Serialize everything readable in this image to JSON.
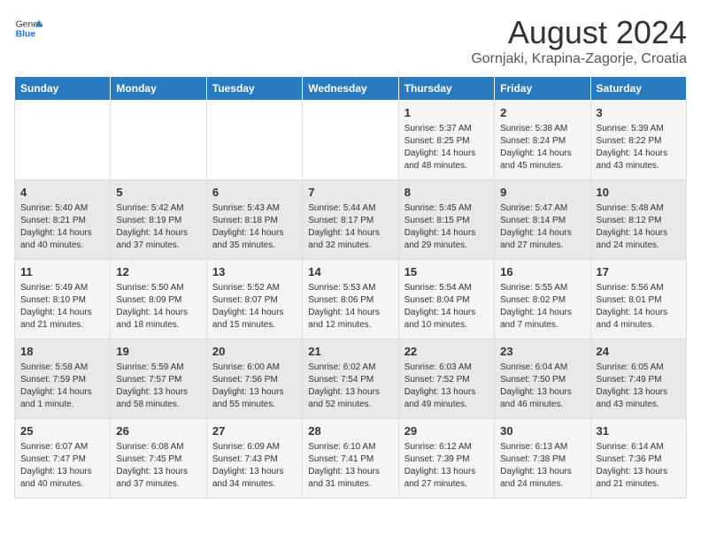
{
  "header": {
    "logo_general": "General",
    "logo_blue": "Blue",
    "month_title": "August 2024",
    "location": "Gornjaki, Krapina-Zagorje, Croatia"
  },
  "weekdays": [
    "Sunday",
    "Monday",
    "Tuesday",
    "Wednesday",
    "Thursday",
    "Friday",
    "Saturday"
  ],
  "weeks": [
    [
      {
        "day": "",
        "info": ""
      },
      {
        "day": "",
        "info": ""
      },
      {
        "day": "",
        "info": ""
      },
      {
        "day": "",
        "info": ""
      },
      {
        "day": "1",
        "info": "Sunrise: 5:37 AM\nSunset: 8:25 PM\nDaylight: 14 hours and 48 minutes."
      },
      {
        "day": "2",
        "info": "Sunrise: 5:38 AM\nSunset: 8:24 PM\nDaylight: 14 hours and 45 minutes."
      },
      {
        "day": "3",
        "info": "Sunrise: 5:39 AM\nSunset: 8:22 PM\nDaylight: 14 hours and 43 minutes."
      }
    ],
    [
      {
        "day": "4",
        "info": "Sunrise: 5:40 AM\nSunset: 8:21 PM\nDaylight: 14 hours and 40 minutes."
      },
      {
        "day": "5",
        "info": "Sunrise: 5:42 AM\nSunset: 8:19 PM\nDaylight: 14 hours and 37 minutes."
      },
      {
        "day": "6",
        "info": "Sunrise: 5:43 AM\nSunset: 8:18 PM\nDaylight: 14 hours and 35 minutes."
      },
      {
        "day": "7",
        "info": "Sunrise: 5:44 AM\nSunset: 8:17 PM\nDaylight: 14 hours and 32 minutes."
      },
      {
        "day": "8",
        "info": "Sunrise: 5:45 AM\nSunset: 8:15 PM\nDaylight: 14 hours and 29 minutes."
      },
      {
        "day": "9",
        "info": "Sunrise: 5:47 AM\nSunset: 8:14 PM\nDaylight: 14 hours and 27 minutes."
      },
      {
        "day": "10",
        "info": "Sunrise: 5:48 AM\nSunset: 8:12 PM\nDaylight: 14 hours and 24 minutes."
      }
    ],
    [
      {
        "day": "11",
        "info": "Sunrise: 5:49 AM\nSunset: 8:10 PM\nDaylight: 14 hours and 21 minutes."
      },
      {
        "day": "12",
        "info": "Sunrise: 5:50 AM\nSunset: 8:09 PM\nDaylight: 14 hours and 18 minutes."
      },
      {
        "day": "13",
        "info": "Sunrise: 5:52 AM\nSunset: 8:07 PM\nDaylight: 14 hours and 15 minutes."
      },
      {
        "day": "14",
        "info": "Sunrise: 5:53 AM\nSunset: 8:06 PM\nDaylight: 14 hours and 12 minutes."
      },
      {
        "day": "15",
        "info": "Sunrise: 5:54 AM\nSunset: 8:04 PM\nDaylight: 14 hours and 10 minutes."
      },
      {
        "day": "16",
        "info": "Sunrise: 5:55 AM\nSunset: 8:02 PM\nDaylight: 14 hours and 7 minutes."
      },
      {
        "day": "17",
        "info": "Sunrise: 5:56 AM\nSunset: 8:01 PM\nDaylight: 14 hours and 4 minutes."
      }
    ],
    [
      {
        "day": "18",
        "info": "Sunrise: 5:58 AM\nSunset: 7:59 PM\nDaylight: 14 hours and 1 minute."
      },
      {
        "day": "19",
        "info": "Sunrise: 5:59 AM\nSunset: 7:57 PM\nDaylight: 13 hours and 58 minutes."
      },
      {
        "day": "20",
        "info": "Sunrise: 6:00 AM\nSunset: 7:56 PM\nDaylight: 13 hours and 55 minutes."
      },
      {
        "day": "21",
        "info": "Sunrise: 6:02 AM\nSunset: 7:54 PM\nDaylight: 13 hours and 52 minutes."
      },
      {
        "day": "22",
        "info": "Sunrise: 6:03 AM\nSunset: 7:52 PM\nDaylight: 13 hours and 49 minutes."
      },
      {
        "day": "23",
        "info": "Sunrise: 6:04 AM\nSunset: 7:50 PM\nDaylight: 13 hours and 46 minutes."
      },
      {
        "day": "24",
        "info": "Sunrise: 6:05 AM\nSunset: 7:49 PM\nDaylight: 13 hours and 43 minutes."
      }
    ],
    [
      {
        "day": "25",
        "info": "Sunrise: 6:07 AM\nSunset: 7:47 PM\nDaylight: 13 hours and 40 minutes."
      },
      {
        "day": "26",
        "info": "Sunrise: 6:08 AM\nSunset: 7:45 PM\nDaylight: 13 hours and 37 minutes."
      },
      {
        "day": "27",
        "info": "Sunrise: 6:09 AM\nSunset: 7:43 PM\nDaylight: 13 hours and 34 minutes."
      },
      {
        "day": "28",
        "info": "Sunrise: 6:10 AM\nSunset: 7:41 PM\nDaylight: 13 hours and 31 minutes."
      },
      {
        "day": "29",
        "info": "Sunrise: 6:12 AM\nSunset: 7:39 PM\nDaylight: 13 hours and 27 minutes."
      },
      {
        "day": "30",
        "info": "Sunrise: 6:13 AM\nSunset: 7:38 PM\nDaylight: 13 hours and 24 minutes."
      },
      {
        "day": "31",
        "info": "Sunrise: 6:14 AM\nSunset: 7:36 PM\nDaylight: 13 hours and 21 minutes."
      }
    ]
  ]
}
